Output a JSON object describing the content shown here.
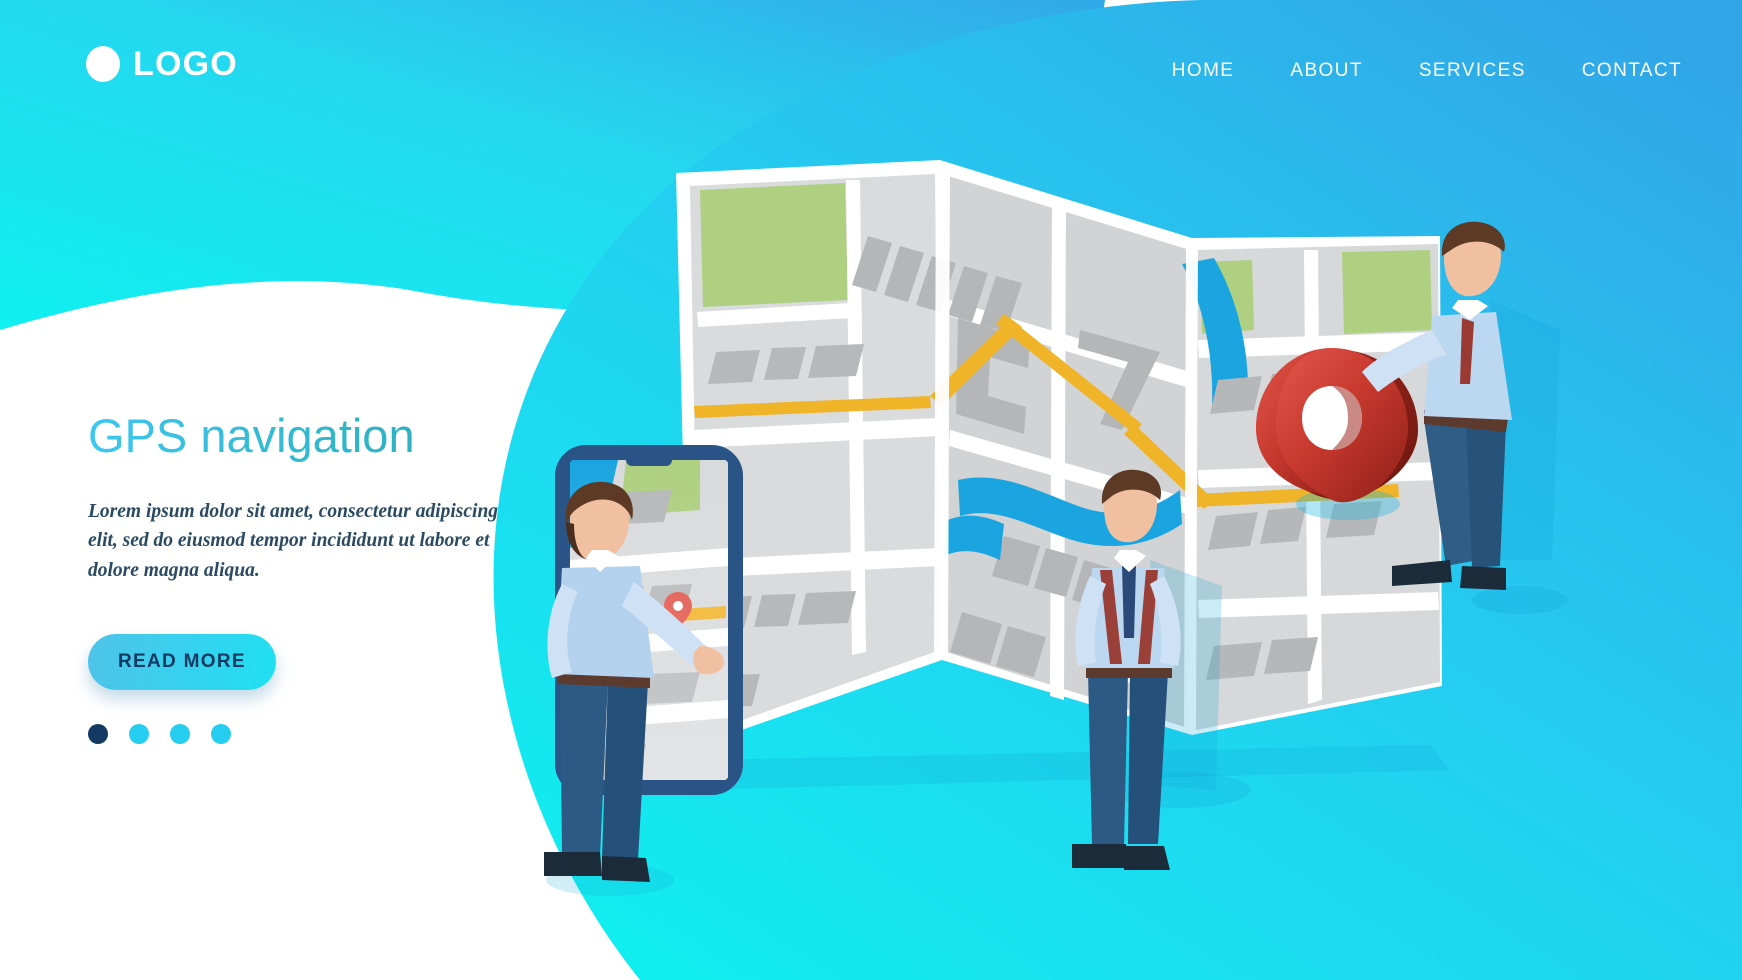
{
  "brand": {
    "logo_text": "LOGO",
    "logo_mark_icon": "circle-logo-icon"
  },
  "nav": {
    "items": [
      {
        "label": "HOME"
      },
      {
        "label": "ABOUT"
      },
      {
        "label": "SERVICES"
      },
      {
        "label": "CONTACT"
      }
    ]
  },
  "hero": {
    "headline": "GPS navigation",
    "paragraph": "Lorem ipsum dolor sit amet, consectetur adipiscing elit, sed do eiusmod tempor incididunt ut labore et dolore magna aliqua.",
    "cta_label": "READ MORE",
    "carousel_dots": [
      {
        "state": "active",
        "color": "#123a63"
      },
      {
        "state": "inactive",
        "color": "#25cdee"
      },
      {
        "state": "inactive",
        "color": "#25cdee"
      },
      {
        "state": "inactive",
        "color": "#25cdee"
      }
    ]
  },
  "illustration": {
    "map_pin_icon": "location-pin-icon",
    "phone_icon": "smartphone-icon",
    "people": [
      {
        "name": "man-with-phone"
      },
      {
        "name": "man-standing-center"
      },
      {
        "name": "man-leaning-on-pin"
      }
    ]
  },
  "colors": {
    "brand_cyan": "#22e4f0",
    "brand_blue": "#29b6ea",
    "accent_navy": "#123a63",
    "pin_red": "#c0392b",
    "map_green": "#a9cd7f",
    "map_gray": "#d4d6d8",
    "map_river": "#1ba5e0",
    "route_yellow": "#f0b429"
  }
}
